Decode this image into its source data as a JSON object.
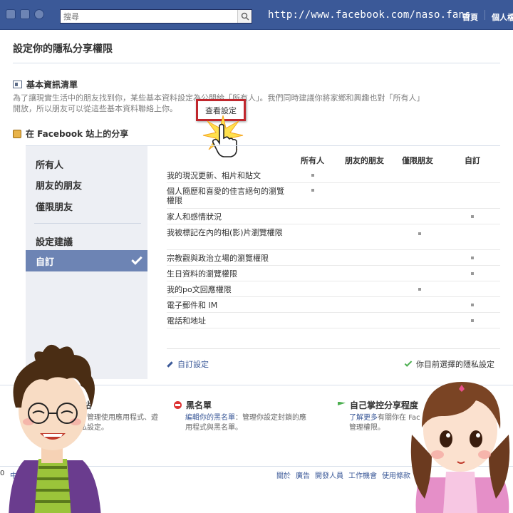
{
  "topbar": {
    "search_placeholder": "搜尋",
    "url_text": "http://www.facebook.com/naso.fans",
    "home_label": "首頁",
    "user_label": "個人檔案"
  },
  "page_title": "設定你的隱私分享權限",
  "basic_info": {
    "title": "基本資訊清單",
    "description": "為了讓現實生活中的朋友找到你，某些基本資料設定為公開給「所有人」。我們同時建議你將家鄉和興趣也對「所有人」開放，所以朋友可以從這些基本資料聯絡上你。",
    "view_settings_label": "查看設定"
  },
  "sharing": {
    "title": "在 Facebook 站上的分享",
    "sidebar": {
      "items": [
        "所有人",
        "朋友的朋友",
        "僅限朋友"
      ],
      "recommended_label": "設定建議",
      "custom_label": "自訂"
    },
    "columns": [
      "所有人",
      "朋友的朋友",
      "僅限朋友",
      "自訂"
    ],
    "rows": [
      {
        "label": "我的現況更新、相片和貼文",
        "setting": "所有人"
      },
      {
        "label": "個人簡歷和喜愛的佳言絕句的瀏覽權限",
        "setting": "所有人"
      },
      {
        "label": "家人和感情狀況",
        "setting": "自訂"
      },
      {
        "label": "我被標記在內的相(影)片瀏覽權限",
        "setting": "僅限朋友"
      },
      {
        "label": "宗教觀與政治立場的瀏覽權限",
        "setting": "自訂"
      },
      {
        "label": "生日資料的瀏覽權限",
        "setting": "自訂"
      },
      {
        "label": "我的po文回應權限",
        "setting": "僅限朋友"
      },
      {
        "label": "電子郵件和 IM",
        "setting": "自訂"
      },
      {
        "label": "電話和地址",
        "setting": "自訂"
      }
    ],
    "custom_link": "自訂設定",
    "current_note": "你目前選擇的隱私設定"
  },
  "bottom": {
    "apps": {
      "title": "站",
      "text1": "：管理使用應用程式、遊",
      "text2": "私設定。"
    },
    "blocklist": {
      "title": "黑名單",
      "link": "編輯你的黑名單",
      "text1": "：管理你設定封鎖的應",
      "text2": "用程式與黑名單。"
    },
    "control": {
      "title": "自己掌控分享程度",
      "link": "了解更多",
      "text1": "有關你在 Fac",
      "text2": "管理權限。"
    }
  },
  "footer": {
    "left_text": "0",
    "language": "中文(",
    "links": [
      "關於",
      "廣告",
      "開發人員",
      "工作機會",
      "使用條款"
    ]
  },
  "colors": {
    "facebook_blue": "#3b5998",
    "highlight_red": "#c0272d",
    "sidebar_bg": "#edeff4",
    "active_item": "#6d84b4"
  },
  "icons": [
    "globe-icon",
    "search-icon",
    "id-card-icon",
    "lock-icon",
    "checkmark-icon",
    "pencil-icon",
    "block-icon",
    "flag-icon",
    "cursor-hand-icon"
  ]
}
